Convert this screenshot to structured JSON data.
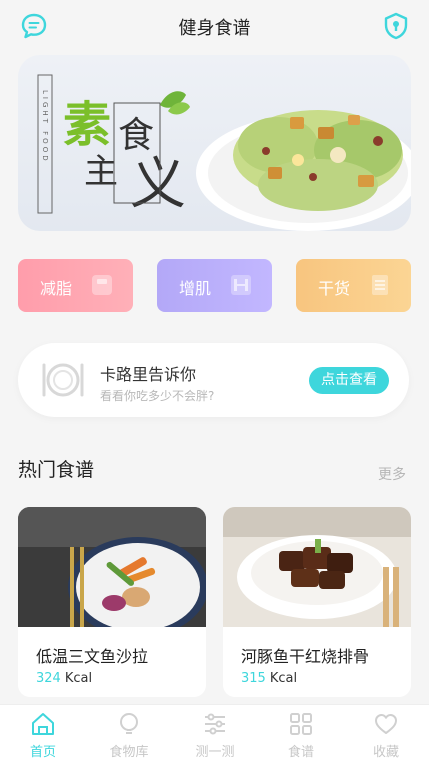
{
  "colors": {
    "accent": "#3ed6dc",
    "cat_fat": "#ff9dab",
    "cat_muscle": "#b3a8f7",
    "cat_dry": "#f8c57f"
  },
  "header": {
    "title": "健身食谱",
    "left_icon": "chat-bubble-icon",
    "right_icon": "shield-icon"
  },
  "banner": {
    "big_text": "素",
    "side_text": "LIGHT FOOD",
    "art_text": [
      "食",
      "主",
      "义"
    ]
  },
  "categories": [
    {
      "label": "减脂",
      "icon": "scale-icon"
    },
    {
      "label": "增肌",
      "icon": "dumbbell-icon"
    },
    {
      "label": "干货",
      "icon": "document-icon"
    }
  ],
  "calorie_card": {
    "title": "卡路里告诉你",
    "subtitle": "看看你吃多少不会胖?",
    "button": "点击查看"
  },
  "hot_recipes": {
    "title": "热门食谱",
    "more": "更多",
    "items": [
      {
        "name": "低温三文鱼沙拉",
        "calories": "324",
        "unit": "Kcal"
      },
      {
        "name": "河豚鱼干红烧排骨",
        "calories": "315",
        "unit": "Kcal"
      }
    ]
  },
  "tabbar": [
    {
      "label": "首页",
      "icon": "home-icon",
      "active": true
    },
    {
      "label": "食物库",
      "icon": "lightbulb-icon",
      "active": false
    },
    {
      "label": "测一测",
      "icon": "sliders-icon",
      "active": false
    },
    {
      "label": "食谱",
      "icon": "grid-icon",
      "active": false
    },
    {
      "label": "收藏",
      "icon": "heart-icon",
      "active": false
    }
  ]
}
